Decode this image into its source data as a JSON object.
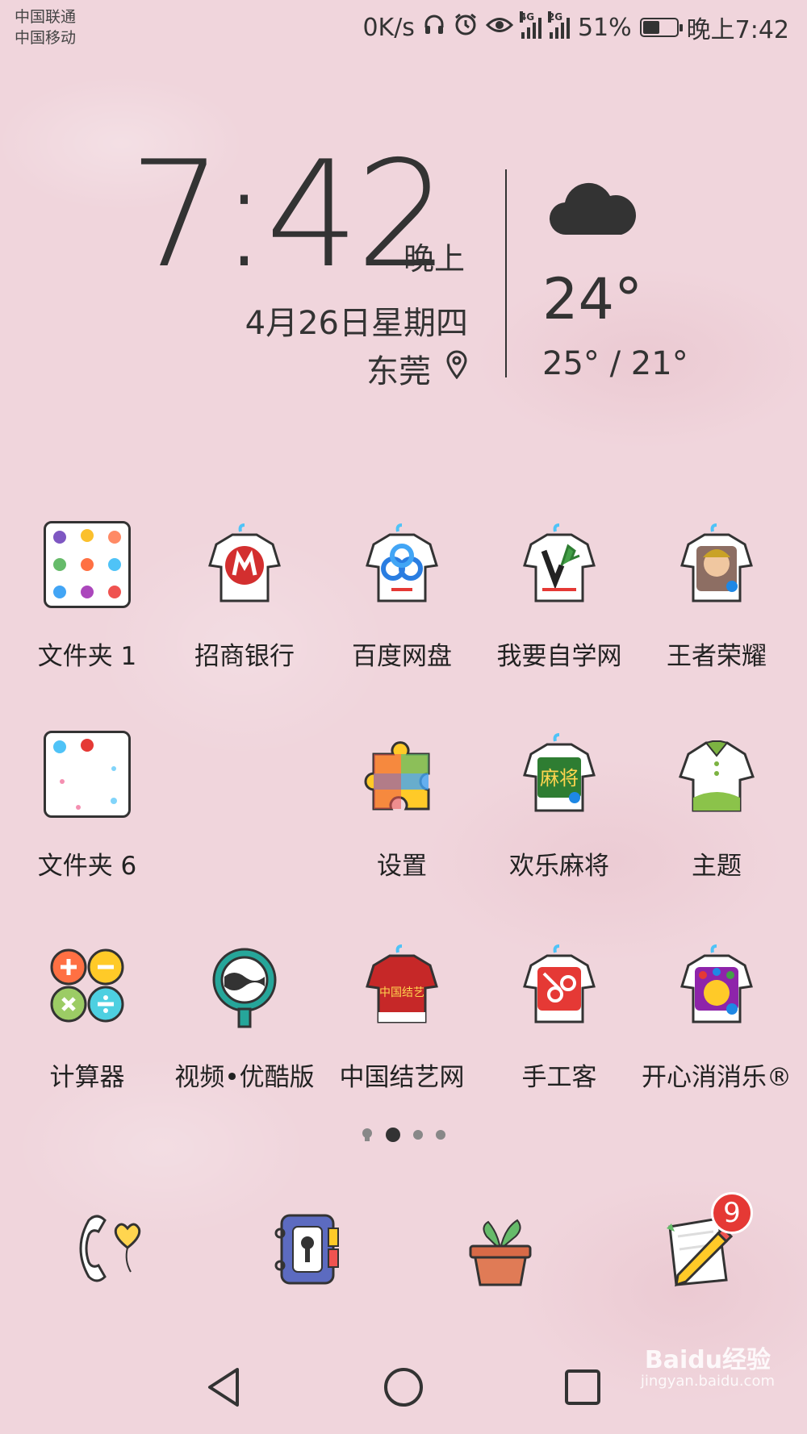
{
  "status_bar": {
    "carrier_1": "中国联通",
    "carrier_2": "中国移动",
    "net_speed": "0K/s",
    "signal_1_tag": "4G",
    "signal_2_tag": "2G",
    "battery_percent_text": "51%",
    "battery_level": 0.51,
    "time": "晚上7:42"
  },
  "clock_widget": {
    "time": "7:42",
    "ampm": "晚上",
    "date": "4月26日星期四",
    "city": "东莞"
  },
  "weather_widget": {
    "icon": "cloud-icon",
    "temperature": "24°",
    "range": "25° / 21°"
  },
  "apps": [
    {
      "name": "folder-1",
      "label": "文件夹 1",
      "icon": "folder-icon"
    },
    {
      "name": "cmb",
      "label": "招商银行",
      "icon": "cmb-bank-icon",
      "color": "#d32f2f"
    },
    {
      "name": "baidu-netdisk",
      "label": "百度网盘",
      "icon": "baidu-netdisk-icon",
      "color": "#2a7de1"
    },
    {
      "name": "woyaozixue",
      "label": "我要自学网",
      "icon": "woyaozixue-icon",
      "color": "#2e7d32"
    },
    {
      "name": "wangzhe",
      "label": "王者荣耀",
      "icon": "honor-of-kings-icon",
      "color": "#c0392b"
    },
    {
      "name": "folder-6",
      "label": "文件夹 6",
      "icon": "folder-icon"
    },
    {
      "name": "settings",
      "label": "设置",
      "icon": "settings-puzzle-icon"
    },
    {
      "name": "mahjong",
      "label": "欢乐麻将",
      "icon": "mahjong-icon",
      "color": "#2e7d32"
    },
    {
      "name": "theme",
      "label": "主题",
      "icon": "theme-shirt-icon",
      "color": "#7cb342"
    },
    {
      "name": "calculator",
      "label": "计算器",
      "icon": "calculator-icon"
    },
    {
      "name": "youku",
      "label": "视频•优酷版",
      "icon": "youku-icon",
      "color": "#26a69a"
    },
    {
      "name": "knot",
      "label": "中国结艺网",
      "icon": "chinese-knot-icon",
      "color": "#c62828"
    },
    {
      "name": "shougongke",
      "label": "手工客",
      "icon": "shougongke-icon",
      "color": "#e53935"
    },
    {
      "name": "xiaoxiaole",
      "label": "开心消消乐®",
      "icon": "happy-elimination-icon",
      "color": "#8e24aa"
    }
  ],
  "page_indicator": {
    "pages": 3,
    "current": 1
  },
  "dock": [
    {
      "name": "phone",
      "icon": "phone-heart-icon"
    },
    {
      "name": "contacts",
      "icon": "contacts-book-icon"
    },
    {
      "name": "plant",
      "icon": "plant-pot-icon"
    },
    {
      "name": "notes",
      "icon": "notepad-pencil-icon",
      "badge": "9"
    }
  ],
  "watermark": {
    "main": "Baidu经验",
    "sub": "jingyan.baidu.com"
  }
}
